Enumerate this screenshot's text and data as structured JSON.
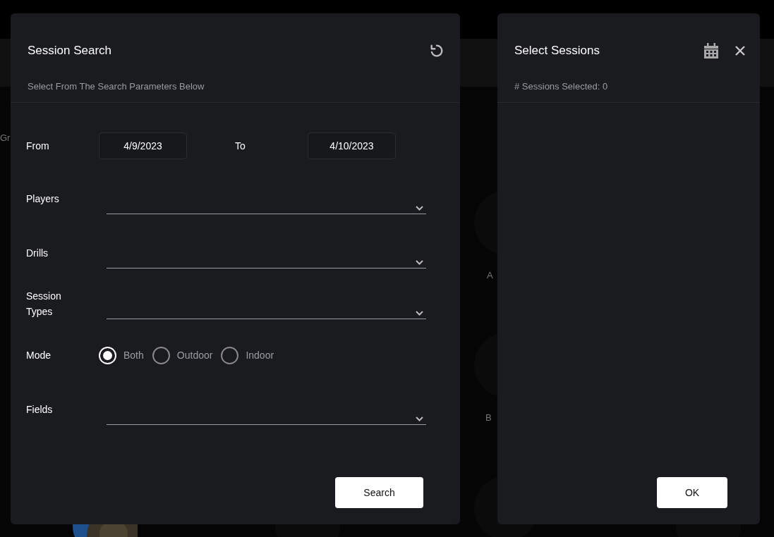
{
  "background": {
    "texts": [
      "Gr",
      "A",
      "B"
    ]
  },
  "search_dialog": {
    "title": "Session Search",
    "subtitle": "Select From The Search Parameters Below",
    "date_range": [
      {
        "label": "From",
        "value": "4/9/2023"
      },
      {
        "label": "To",
        "value": "4/10/2023"
      }
    ],
    "dropdowns": [
      {
        "label": "Players"
      },
      {
        "label": "Drills"
      },
      {
        "label": "Session Types"
      }
    ],
    "mode": {
      "label": "Mode",
      "options": [
        {
          "label": "Both",
          "selected": true
        },
        {
          "label": "Outdoor",
          "selected": false
        },
        {
          "label": "Indoor",
          "selected": false
        }
      ]
    },
    "fields_dropdown": {
      "label": "Fields"
    },
    "button": "Search"
  },
  "select_dialog": {
    "title": "Select Sessions",
    "count_text": "# Sessions Selected: 0",
    "button": "OK"
  }
}
